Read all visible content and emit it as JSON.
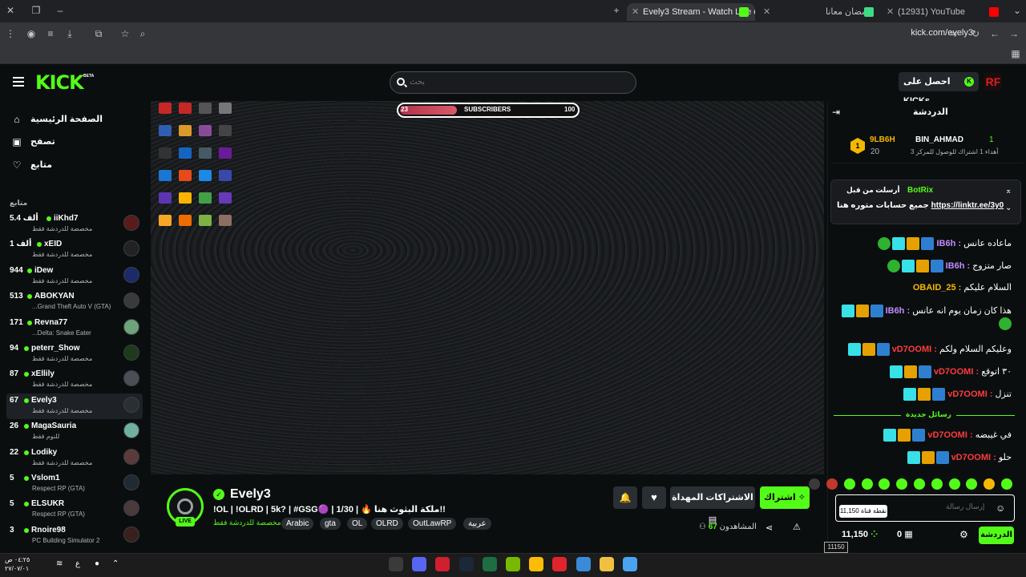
{
  "browser": {
    "tabs": [
      {
        "title": "Evely3 Stream - Watch Live on",
        "active": true
      },
      {
        "title": "رمضان معانا",
        "active": false
      },
      {
        "title": "(12931) YouTube",
        "active": false
      }
    ],
    "url": "kick.com/evely3"
  },
  "header": {
    "logo": "KICK",
    "beta": "BETA",
    "search_placeholder": "بحث",
    "get_kicks": "احصل على KICKs",
    "user_initials": "RF"
  },
  "sidebar": {
    "nav": [
      {
        "label": "الصفحة الرئيسية",
        "icon": "home-icon"
      },
      {
        "label": "تصفح",
        "icon": "browse-icon"
      },
      {
        "label": "متابع",
        "icon": "heart-icon"
      }
    ],
    "following_heading": "متابع",
    "channels": [
      {
        "name": "iiKhd7",
        "viewers": "5.4 ألف",
        "category": "مخصصة للدردشة فقط"
      },
      {
        "name": "xEID",
        "viewers": "1 ألف",
        "category": "مخصصة للدردشة فقط"
      },
      {
        "name": "iDew",
        "viewers": "944",
        "category": "مخصصة للدردشة فقط"
      },
      {
        "name": "ABOKYAN",
        "viewers": "513",
        "category": "Grand Theft Auto V (GTA)..."
      },
      {
        "name": "Revna77",
        "viewers": "171",
        "category": "Delta: Snake Eater..."
      },
      {
        "name": "peterr_Show",
        "viewers": "94",
        "category": "مخصصة للدردشة فقط"
      },
      {
        "name": "xEllily",
        "viewers": "87",
        "category": "مخصصة للدردشة فقط"
      },
      {
        "name": "Evely3",
        "viewers": "67",
        "category": "مخصصة للدردشة فقط",
        "selected": true
      },
      {
        "name": "MagaSauria",
        "viewers": "26",
        "category": "للنوم فقط"
      },
      {
        "name": "Lodiky",
        "viewers": "22",
        "category": "مخصصة للدردشة فقط"
      },
      {
        "name": "Vslom1",
        "viewers": "5",
        "category": "Respect RP (GTA)"
      },
      {
        "name": "ELSUKR",
        "viewers": "5",
        "category": "Respect RP (GTA)"
      },
      {
        "name": "Rnoire98",
        "viewers": "3",
        "category": "PC Building Simulator 2"
      }
    ]
  },
  "video": {
    "sub_goal": {
      "current": "23",
      "label": "SUBSCRIBERS",
      "goal": "100",
      "fraction": 0.23
    }
  },
  "stream": {
    "streamer": "Evely3",
    "live_label": "LIVE",
    "title": "!OL | !OLRD | 5k? | #GSG🟣 | 1/30 | 🔥 ملكة البثوث هنا!!",
    "category": "مخصصة للدردشة فقط",
    "tags": [
      "Arabic",
      "gta",
      "OL",
      "OLRD",
      "OutLawRP",
      "عربية"
    ],
    "subscribe": "اشتراك",
    "gift": "الاشتراكات المهداة",
    "viewers_label": "المشاهدون",
    "viewers": "67"
  },
  "chat": {
    "title": "الدردشة",
    "leaderboard": {
      "top_name": "9LB6H",
      "top_value": "20",
      "second_name": "BIN_AHMAD",
      "second_rank": "1",
      "second_desc": "أهداء 1 اشتراك للوصول للمركز 3"
    },
    "pinned": {
      "user": "BotRix",
      "by": "أرسلت من قبل",
      "text": "جميع حسابات متوره هنا",
      "link": "https://linktr.ee/3y0"
    },
    "messages": [
      {
        "user": "IB6h",
        "text": "ماعاده عانس"
      },
      {
        "user": "IB6h",
        "text": "صار متزوج"
      },
      {
        "user": "OBAID_25",
        "text": "السلام عليكم"
      },
      {
        "user": "IB6h",
        "text": "هذا كان زمان يوم انه عانس"
      },
      {
        "user": "vD7OOMI",
        "text": "وعليكم السلام ولكم"
      },
      {
        "user": "vD7OOMI",
        "text": "٣٠ اتوقع"
      },
      {
        "user": "vD7OOMI",
        "text": "تنزل"
      },
      {
        "user": "vD7OOMI",
        "text": "في غيبضه"
      },
      {
        "user": "vD7OOMI",
        "text": "حلو"
      }
    ],
    "new_messages": "رسائل جديدة",
    "input_placeholder": "إرسال رسالة",
    "tooltip": "11,150 نقطة قناة",
    "points": "11,150",
    "points_tip": "11150",
    "kicks": "0",
    "send": "الدردشة"
  },
  "taskbar": {
    "time": "٠٤:٢٥ ص",
    "date": "٢٧/٠٧/٠١",
    "lang": "ع"
  }
}
